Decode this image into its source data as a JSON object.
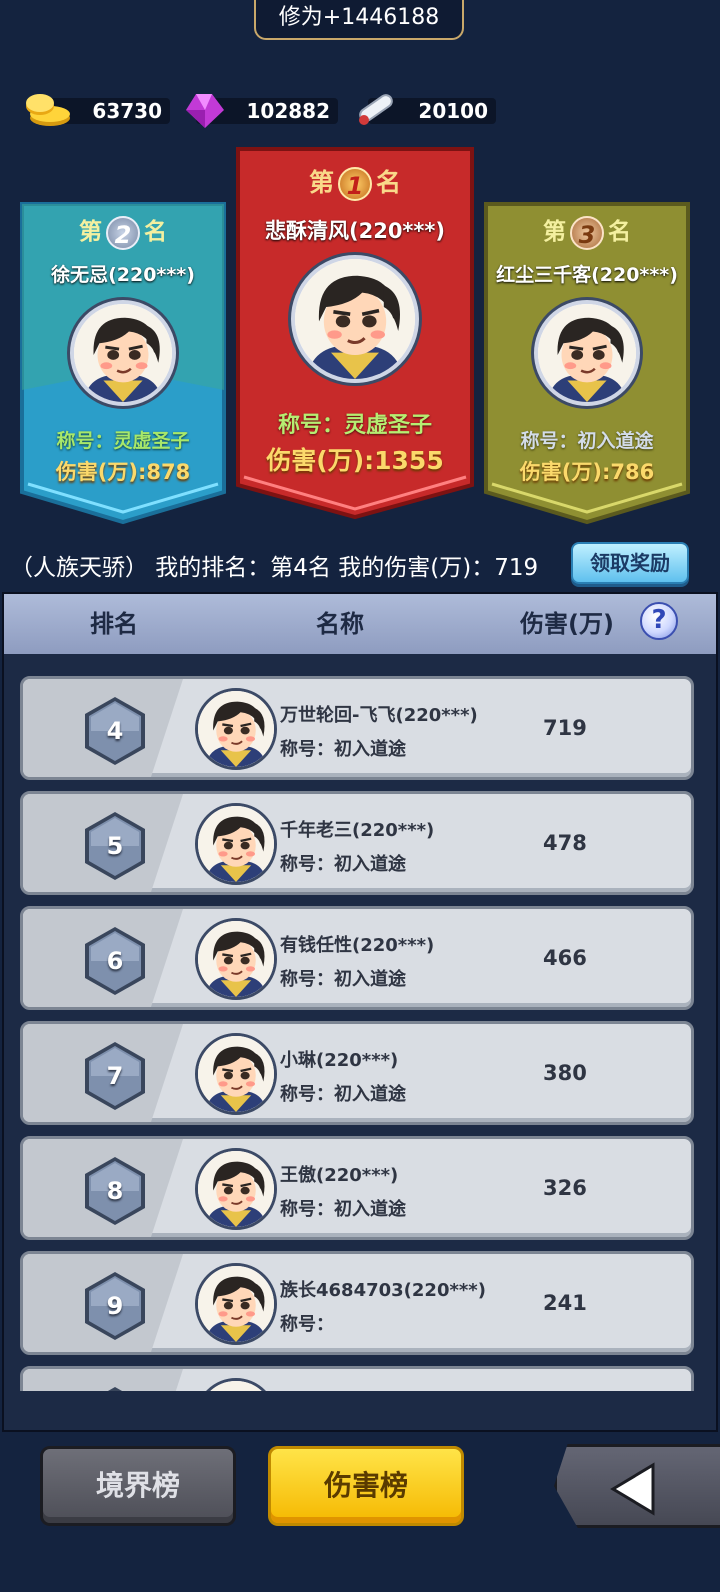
{
  "header": {
    "xiuwei": "修为+1446188"
  },
  "currency": [
    {
      "icon": "gold-coin-icon",
      "value": "63730"
    },
    {
      "icon": "purple-gem-icon",
      "value": "102882"
    },
    {
      "icon": "scroll-icon",
      "value": "20100"
    }
  ],
  "podium": {
    "first": {
      "prefix": "第",
      "rank": "1",
      "suffix": "名",
      "name": "悲酥清风(220***)",
      "title": "称号：灵虚圣子",
      "damage": "伤害(万):1355"
    },
    "second": {
      "prefix": "第",
      "rank": "2",
      "suffix": "名",
      "name": "徐无忌(220***)",
      "title": "称号：灵虚圣子",
      "damage": "伤害(万):878"
    },
    "third": {
      "prefix": "第",
      "rank": "3",
      "suffix": "名",
      "name": "红尘三千客(220***)",
      "title": "称号：初入道途",
      "damage": "伤害(万):786"
    }
  },
  "my_rank": {
    "text": "（人族天骄） 我的排名：第4名  我的伤害(万)：719",
    "claim_label": "领取奖励"
  },
  "table": {
    "headers": [
      "排名",
      "名称",
      "伤害(万)"
    ],
    "help": "?",
    "rows": [
      {
        "rank": "4",
        "name": "万世轮回-飞飞(220***)",
        "title": "称号：初入道途",
        "damage": "719"
      },
      {
        "rank": "5",
        "name": "千年老三(220***)",
        "title": "称号：初入道途",
        "damage": "478"
      },
      {
        "rank": "6",
        "name": "有钱任性(220***)",
        "title": "称号：初入道途",
        "damage": "466"
      },
      {
        "rank": "7",
        "name": "小琳(220***)",
        "title": "称号：初入道途",
        "damage": "380"
      },
      {
        "rank": "8",
        "name": "王傲(220***)",
        "title": "称号：初入道途",
        "damage": "326"
      },
      {
        "rank": "9",
        "name": "族长4684703(220***)",
        "title": "称号：",
        "damage": "241"
      }
    ]
  },
  "tabs": {
    "realm": "境界榜",
    "damage": "伤害榜"
  },
  "back": {
    "icon": "back-arrow-icon"
  }
}
